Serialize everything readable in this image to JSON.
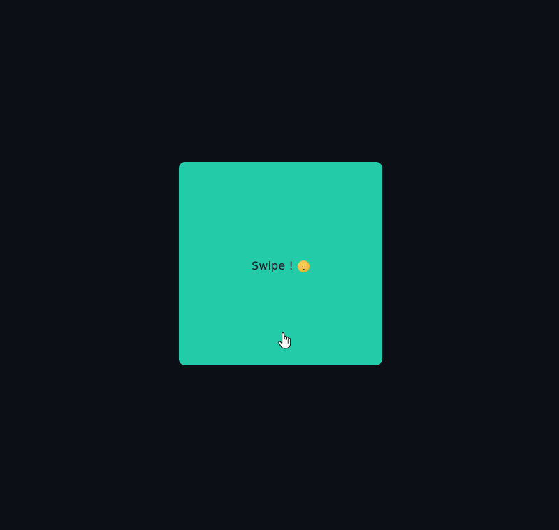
{
  "page": {
    "background_color": "#0c1016"
  },
  "card": {
    "label": "Swipe !",
    "emoji_icon": "pensive-face-icon",
    "background_color": "#23cba8"
  },
  "cursor": {
    "icon": "hand-pointer-icon"
  }
}
